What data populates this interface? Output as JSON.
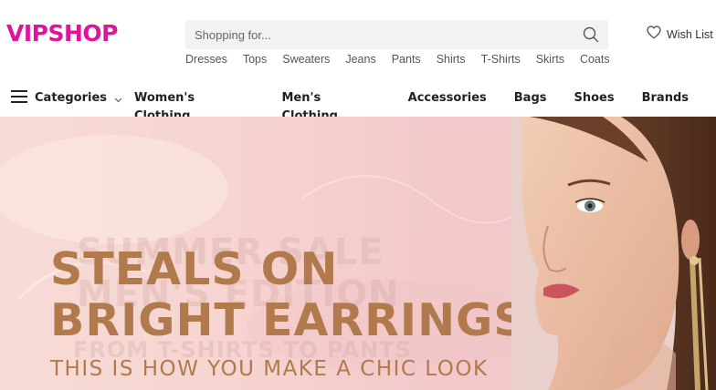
{
  "brand": {
    "logo_text": "VIPSHOP",
    "color": "#e0139c"
  },
  "search": {
    "placeholder": "Shopping for...",
    "icon": "search-icon"
  },
  "quick_links": [
    "Dresses",
    "Tops",
    "Sweaters",
    "Jeans",
    "Pants",
    "Shirts",
    "T-Shirts",
    "Skirts",
    "Coats"
  ],
  "wishlist": {
    "label": "Wish List",
    "icon": "heart-icon"
  },
  "nav": {
    "categories_label": "Categories",
    "items": [
      "Women's Clothing",
      "Men's Clothing",
      "Accessories",
      "Bags",
      "Shoes",
      "Brands"
    ]
  },
  "banner": {
    "headline_line1": "STEALS ON",
    "headline_line2": "BRIGHT EARRINGS",
    "tagline": "THIS IS HOW YOU MAKE A CHIC LOOK",
    "ghost_line1": "SUMMER SALE",
    "ghost_line2": "MEN'S EDITION",
    "ghost_line3": "FROM T-SHIRTS TO PANTS",
    "text_color": "#b07a4d",
    "background": "#f6d3d0"
  }
}
